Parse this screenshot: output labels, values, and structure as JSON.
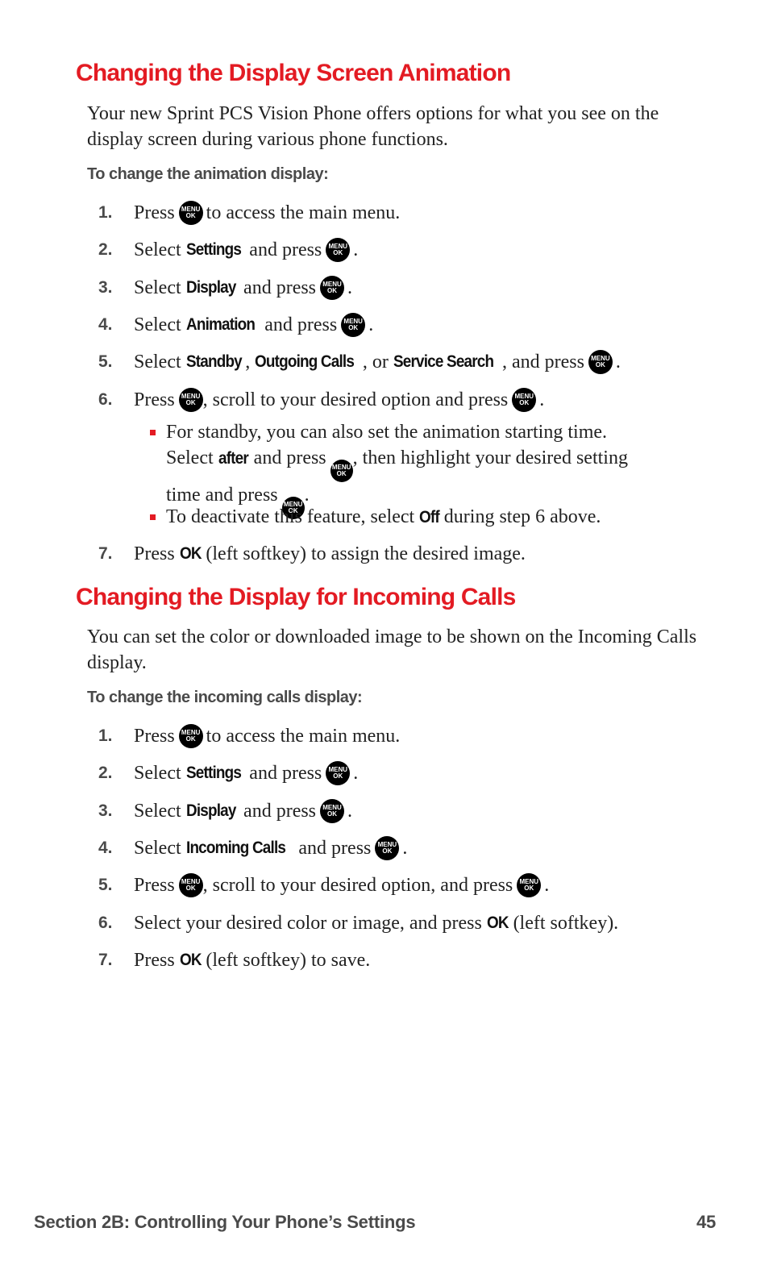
{
  "section1": {
    "heading": "Changing the Display Screen Animation",
    "intro": "Your new Sprint PCS Vision Phone offers options for what you see on the display screen during various phone functions.",
    "subheading": "To change the animation display:",
    "steps": [
      {
        "num": "1.",
        "a": "Press",
        "b": "to access the main menu."
      },
      {
        "num": "2.",
        "a": "Select",
        "bold": "Settings",
        "b": "and press"
      },
      {
        "num": "3.",
        "a": "Select",
        "bold": "Display",
        "b": "and press"
      },
      {
        "num": "4.",
        "a": "Select",
        "bold": "Animation",
        "b": "and press"
      },
      {
        "num": "5.",
        "a": "Select",
        "bold1": "Standby",
        "sep1": ",",
        "bold2": "Outgoing Calls",
        "sep2": ", or",
        "bold3": "Service Search",
        "b": ", and press"
      },
      {
        "num": "6.",
        "a": "Press",
        "b": ", scroll to your desired option and press"
      },
      {
        "num": "7.",
        "a": "Press",
        "bold": "OK",
        "b": "(left softkey) to assign the desired image."
      }
    ],
    "bullets": [
      {
        "line1": "For standby, you can also set the animation starting time.",
        "select": "Select",
        "bold": "after",
        "mid": "and press",
        "after_key": ", then highlight your desired setting",
        "line3": "time and press"
      },
      {
        "a": "To deactivate this feature, select",
        "bold": "Off",
        "b": "during step 6 above."
      }
    ]
  },
  "section2": {
    "heading": "Changing the Display for Incoming Calls",
    "intro": "You can set the color or downloaded image to be shown on the Incoming Calls display.",
    "subheading": "To change the incoming calls display:",
    "steps": [
      {
        "num": "1.",
        "a": "Press",
        "b": "to access the main menu."
      },
      {
        "num": "2.",
        "a": "Select",
        "bold": "Settings",
        "b": "and press"
      },
      {
        "num": "3.",
        "a": "Select",
        "bold": "Display",
        "b": "and press"
      },
      {
        "num": "4.",
        "a": "Select",
        "bold": "Incoming Calls",
        "b": "and press"
      },
      {
        "num": "5.",
        "a": "Press",
        "b": ", scroll to your desired option, and press"
      },
      {
        "num": "6.",
        "a": "Select your desired color or image, and press",
        "bold": "OK",
        "b": "(left softkey)."
      },
      {
        "num": "7.",
        "a": "Press",
        "bold": "OK",
        "b": "(left softkey) to save."
      }
    ]
  },
  "menu_key": {
    "top": "MENU",
    "bottom": "OK"
  },
  "period": ".",
  "footer": {
    "section": "Section 2B: Controlling Your Phone’s Settings",
    "page": "45"
  },
  "colors": {
    "heading": "#e31b23",
    "bullet": "#e31b23",
    "key": "#000000"
  }
}
